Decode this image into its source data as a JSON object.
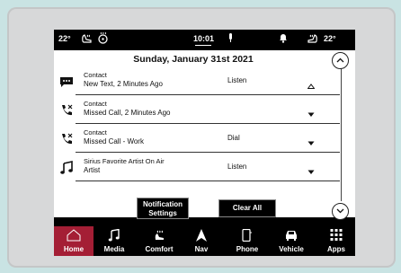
{
  "status": {
    "temp_left": "22°",
    "time": "10:01",
    "temp_right": "22°"
  },
  "panel": {
    "date": "Sunday, January 31st 2021",
    "rows": [
      {
        "icon": "message-icon",
        "line1": "Contact",
        "line2": "New Text, 2 Minutes Ago",
        "action": "Listen",
        "expanded": true
      },
      {
        "icon": "missed-call-icon",
        "line1": "Contact",
        "line2": "Missed Call, 2 Minutes Ago",
        "action": "",
        "expanded": false
      },
      {
        "icon": "missed-call-icon",
        "line1": "Contact",
        "line2": "Missed Call - Work",
        "action": "Dial",
        "expanded": false
      },
      {
        "icon": "music-note-icon",
        "line1": "Sirius Favorite Artist On Air",
        "line2": "Artist",
        "action": "Listen",
        "expanded": false
      }
    ]
  },
  "buttons": {
    "notification_settings": "Notification Settings",
    "clear_all": "Clear All"
  },
  "nav": [
    {
      "label": "Home",
      "icon": "home-icon",
      "active": true
    },
    {
      "label": "Media",
      "icon": "music-note-icon",
      "active": false
    },
    {
      "label": "Comfort",
      "icon": "comfort-icon",
      "active": false
    },
    {
      "label": "Nav",
      "icon": "navigation-arrow-icon",
      "active": false
    },
    {
      "label": "Phone",
      "icon": "phone-icon",
      "active": false
    },
    {
      "label": "Vehicle",
      "icon": "car-icon",
      "active": false
    },
    {
      "label": "Apps",
      "icon": "apps-grid-icon",
      "active": false
    }
  ],
  "colors": {
    "active_nav": "#a41e35",
    "bezel": "#d7d8d9",
    "background": "#c9e3e3"
  }
}
